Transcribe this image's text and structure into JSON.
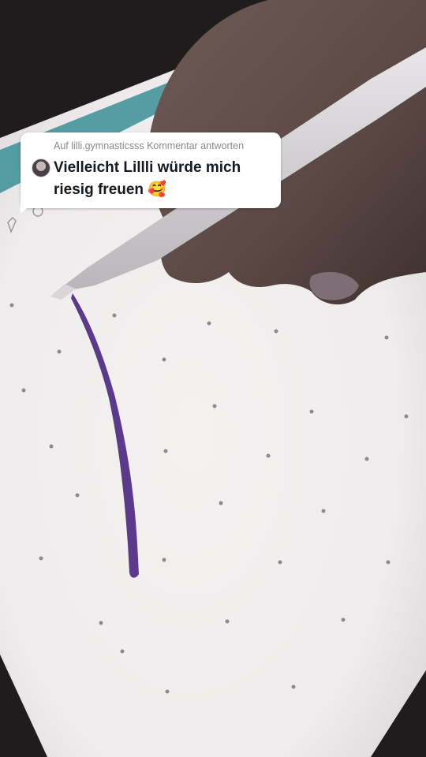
{
  "reply_card": {
    "header": "Auf lilli.gymnasticsss Kommentar antworten",
    "comment": "Vielleicht Lillli würde mich riesig freuen 🥰",
    "avatar_icon": "user-avatar"
  },
  "colors": {
    "stroke": "#5b3a8c",
    "paper": "#f2f0ef",
    "dots": "#8c8a8c"
  }
}
